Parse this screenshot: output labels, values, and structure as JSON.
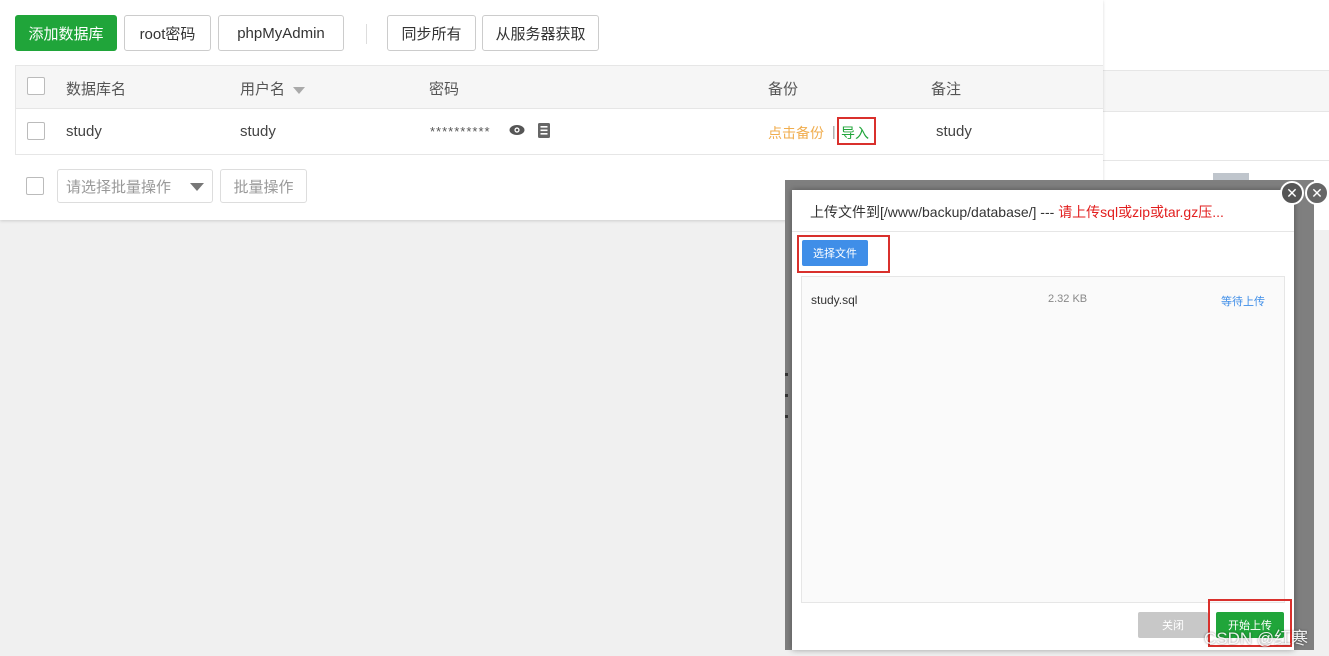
{
  "toolbar": {
    "add_db": "添加数据库",
    "root_pwd": "root密码",
    "phpmyadmin": "phpMyAdmin",
    "sync_all": "同步所有",
    "fetch_from_server": "从服务器获取"
  },
  "table": {
    "headers": {
      "db_name": "数据库名",
      "user": "用户名",
      "password": "密码",
      "backup": "备份",
      "note": "备注"
    },
    "rows": [
      {
        "db_name": "study",
        "user": "study",
        "password_mask": "**********",
        "backup_action": "点击备份",
        "import_action": "导入",
        "note": "study"
      }
    ]
  },
  "batch": {
    "select_placeholder": "请选择批量操作",
    "batch_button": "批量操作"
  },
  "upload_modal": {
    "title_prefix": "上传文件到[/www/backup/database/] --- ",
    "title_warning": "请上传sql或zip或tar.gz压...",
    "choose_file": "选择文件",
    "files": [
      {
        "name": "study.sql",
        "size": "2.32 KB",
        "status": "等待上传"
      }
    ],
    "close_button": "关闭",
    "start_upload": "开始上传"
  },
  "watermark": "CSDN @红寒",
  "colors": {
    "primary_green": "#20a53a",
    "accent_blue": "#3f8ee8",
    "warning_red": "#e21e1e",
    "backup_orange": "#f0ad4e",
    "highlight_red": "#d9302c"
  }
}
